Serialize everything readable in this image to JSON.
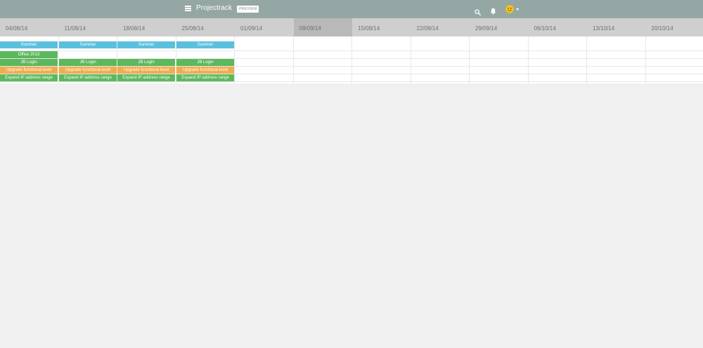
{
  "app": {
    "title": "Projectrack",
    "badge": "PREVIEW",
    "icons": [
      "menu-icon",
      "search-icon",
      "bell-icon",
      "smiley-avatar-icon",
      "chevron-down-icon"
    ]
  },
  "colors": {
    "topbar": "#95a7a5",
    "header": "#cfcfcf",
    "current_week": "#b9b9b9",
    "blue": "#5bc0de",
    "green": "#5cb85c",
    "orange": "#f0ad4e"
  },
  "weeks": [
    "04/08/14",
    "11/08/14",
    "18/08/14",
    "25/08/14",
    "01/09/14",
    "08/09/14",
    "15/09/14",
    "22/09/14",
    "29/09/14",
    "06/10/14",
    "13/10/14",
    "20/10/14"
  ],
  "current_week": "08/09/14",
  "rows": [
    {
      "label": "Summer",
      "color": "blue",
      "weeks": [
        0,
        1,
        2,
        3
      ]
    },
    {
      "label": "Office 2013",
      "color": "green",
      "weeks": [
        0
      ]
    },
    {
      "label": "JB Login",
      "color": "green",
      "weeks": [
        0,
        1,
        2,
        3
      ]
    },
    {
      "label": "Upgrade functional level",
      "color": "orange",
      "weeks": [
        0,
        1,
        2,
        3
      ]
    },
    {
      "label": "Expand IP address range",
      "color": "green",
      "weeks": [
        0,
        1,
        2,
        3
      ]
    }
  ]
}
